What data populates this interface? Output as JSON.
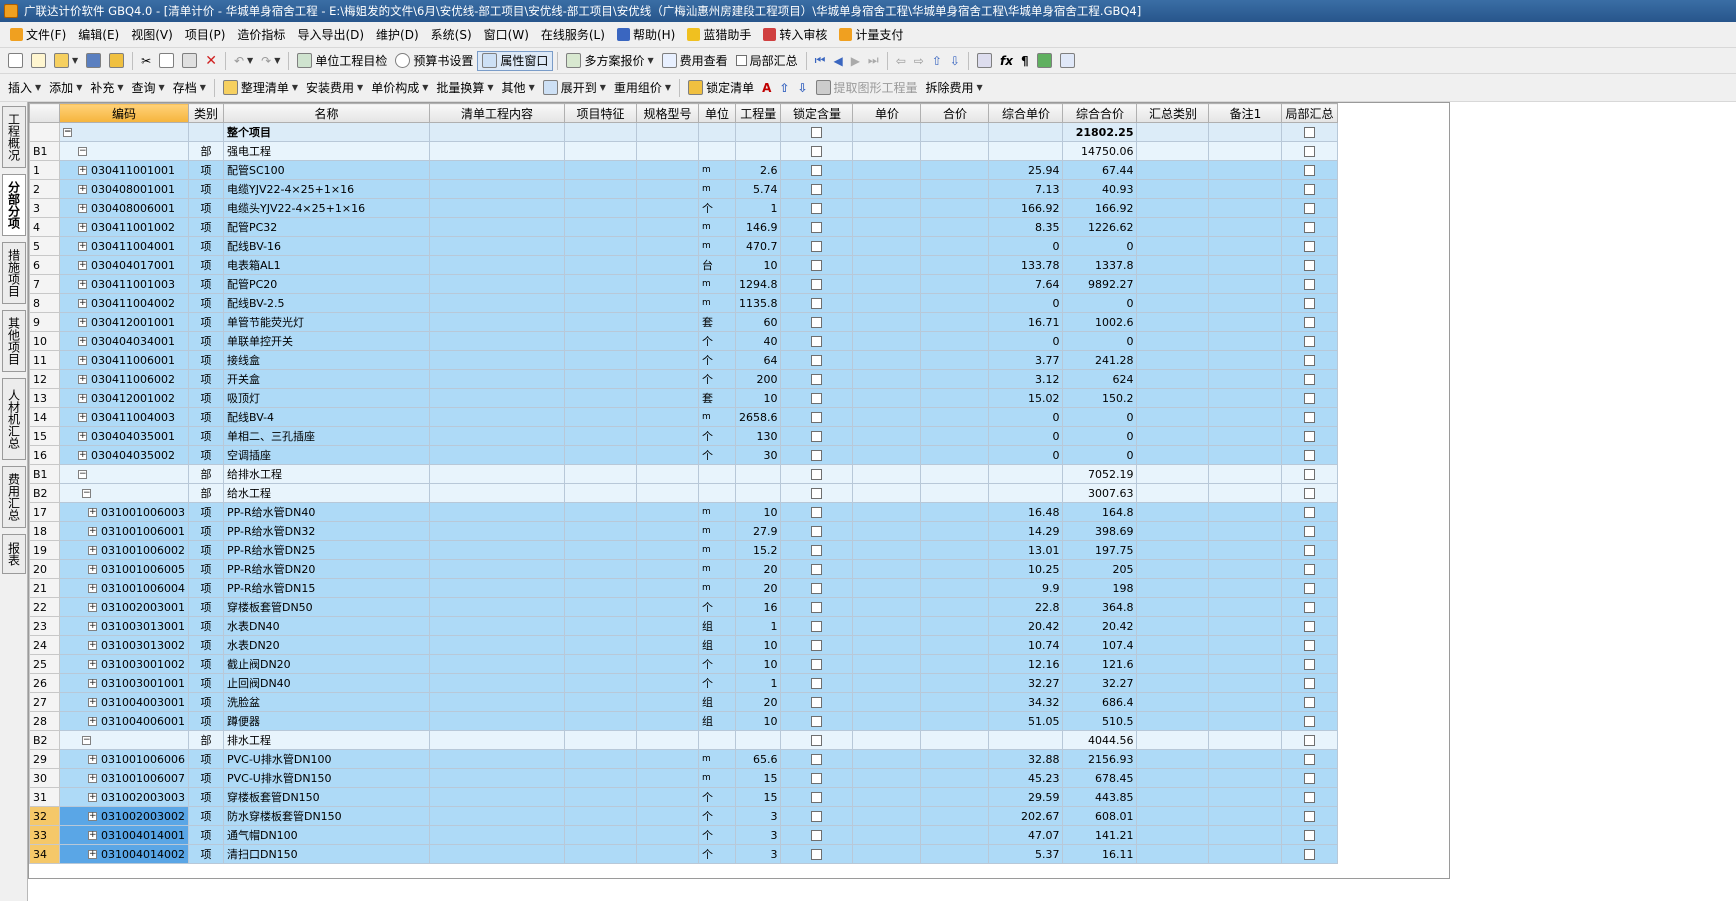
{
  "window": {
    "title": "广联达计价软件 GBQ4.0 - [清单计价 - 华城单身宿舍工程 - E:\\梅姐发的文件\\6月\\安优线-部工项目\\安优线-部工项目\\安优线（广梅汕惠州房建段工程项目）\\华城单身宿舍工程\\华城单身宿舍工程\\华城单身宿舍工程.GBQ4]"
  },
  "menu": [
    "文件(F)",
    "编辑(E)",
    "视图(V)",
    "项目(P)",
    "造价指标",
    "导入导出(D)",
    "维护(D)",
    "系统(S)",
    "窗口(W)",
    "在线服务(L)",
    "帮助(H)",
    "蓝猎助手",
    "转入审核",
    "计量支付"
  ],
  "toolbar1": {
    "unit_target": "单位工程目检",
    "budget_setting": "预算书设置",
    "property_window": "属性窗口",
    "multi_quote": "多方案报价",
    "fee_view": "费用查看",
    "local_summary": "局部汇总"
  },
  "toolbar2": [
    "插入",
    "添加",
    "补充",
    "查询",
    "存档",
    "整理清单",
    "安装费用",
    "单价构成",
    "批量换算",
    "其他",
    "展开到",
    "重用组价",
    "锁定清单",
    "提取图形工程量",
    "拆除费用"
  ],
  "left_tabs": [
    "工程概况",
    "分部分项",
    "措施项目",
    "其他项目",
    "人材机汇总",
    "费用汇总",
    "报表"
  ],
  "columns": [
    "编码",
    "类别",
    "名称",
    "清单工程内容",
    "项目特征",
    "规格型号",
    "单位",
    "工程量",
    "锁定含量",
    "单价",
    "合价",
    "综合单价",
    "综合合价",
    "汇总类别",
    "备注1",
    "局部汇总"
  ],
  "rows": [
    {
      "t": "total",
      "no": "",
      "code": "",
      "cat": "",
      "name": "整个项目",
      "unit": "",
      "qty": "",
      "price": "",
      "total": "21802.25"
    },
    {
      "t": "section",
      "no": "B1",
      "code": "",
      "cat": "部",
      "name": "强电工程",
      "unit": "",
      "qty": "",
      "price": "",
      "total": "14750.06"
    },
    {
      "t": "item",
      "no": "1",
      "code": "030411001001",
      "cat": "项",
      "name": "配管SC100",
      "unit": "m",
      "qty": "2.6",
      "price": "25.94",
      "total": "67.44"
    },
    {
      "t": "item",
      "no": "2",
      "code": "030408001001",
      "cat": "项",
      "name": "电缆YJV22-4×25+1×16",
      "unit": "m",
      "qty": "5.74",
      "price": "7.13",
      "total": "40.93"
    },
    {
      "t": "item",
      "no": "3",
      "code": "030408006001",
      "cat": "项",
      "name": "电缆头YJV22-4×25+1×16",
      "unit": "个",
      "qty": "1",
      "price": "166.92",
      "total": "166.92"
    },
    {
      "t": "item",
      "no": "4",
      "code": "030411001002",
      "cat": "项",
      "name": "配管PC32",
      "unit": "m",
      "qty": "146.9",
      "price": "8.35",
      "total": "1226.62"
    },
    {
      "t": "item",
      "no": "5",
      "code": "030411004001",
      "cat": "项",
      "name": "配线BV-16",
      "unit": "m",
      "qty": "470.7",
      "price": "0",
      "total": "0"
    },
    {
      "t": "item",
      "no": "6",
      "code": "030404017001",
      "cat": "项",
      "name": "电表箱AL1",
      "unit": "台",
      "qty": "10",
      "price": "133.78",
      "total": "1337.8"
    },
    {
      "t": "item",
      "no": "7",
      "code": "030411001003",
      "cat": "项",
      "name": "配管PC20",
      "unit": "m",
      "qty": "1294.8",
      "price": "7.64",
      "total": "9892.27"
    },
    {
      "t": "item",
      "no": "8",
      "code": "030411004002",
      "cat": "项",
      "name": "配线BV-2.5",
      "unit": "m",
      "qty": "1135.8",
      "price": "0",
      "total": "0"
    },
    {
      "t": "item",
      "no": "9",
      "code": "030412001001",
      "cat": "项",
      "name": "单管节能荧光灯",
      "unit": "套",
      "qty": "60",
      "price": "16.71",
      "total": "1002.6"
    },
    {
      "t": "item",
      "no": "10",
      "code": "030404034001",
      "cat": "项",
      "name": "单联单控开关",
      "unit": "个",
      "qty": "40",
      "price": "0",
      "total": "0"
    },
    {
      "t": "item",
      "no": "11",
      "code": "030411006001",
      "cat": "项",
      "name": "接线盒",
      "unit": "个",
      "qty": "64",
      "price": "3.77",
      "total": "241.28"
    },
    {
      "t": "item",
      "no": "12",
      "code": "030411006002",
      "cat": "项",
      "name": "开关盒",
      "unit": "个",
      "qty": "200",
      "price": "3.12",
      "total": "624"
    },
    {
      "t": "item",
      "no": "13",
      "code": "030412001002",
      "cat": "项",
      "name": "吸顶灯",
      "unit": "套",
      "qty": "10",
      "price": "15.02",
      "total": "150.2"
    },
    {
      "t": "item",
      "no": "14",
      "code": "030411004003",
      "cat": "项",
      "name": "配线BV-4",
      "unit": "m",
      "qty": "2658.6",
      "price": "0",
      "total": "0"
    },
    {
      "t": "item",
      "no": "15",
      "code": "030404035001",
      "cat": "项",
      "name": "单相二、三孔插座",
      "unit": "个",
      "qty": "130",
      "price": "0",
      "total": "0"
    },
    {
      "t": "item",
      "no": "16",
      "code": "030404035002",
      "cat": "项",
      "name": "空调插座",
      "unit": "个",
      "qty": "30",
      "price": "0",
      "total": "0"
    },
    {
      "t": "section",
      "no": "B1",
      "code": "",
      "cat": "部",
      "name": "给排水工程",
      "unit": "",
      "qty": "",
      "price": "",
      "total": "7052.19"
    },
    {
      "t": "section2",
      "no": "B2",
      "code": "",
      "cat": "部",
      "name": "给水工程",
      "unit": "",
      "qty": "",
      "price": "",
      "total": "3007.63"
    },
    {
      "t": "item2",
      "no": "17",
      "code": "031001006003",
      "cat": "项",
      "name": "PP-R给水管DN40",
      "unit": "m",
      "qty": "10",
      "price": "16.48",
      "total": "164.8"
    },
    {
      "t": "item2",
      "no": "18",
      "code": "031001006001",
      "cat": "项",
      "name": "PP-R给水管DN32",
      "unit": "m",
      "qty": "27.9",
      "price": "14.29",
      "total": "398.69"
    },
    {
      "t": "item2",
      "no": "19",
      "code": "031001006002",
      "cat": "项",
      "name": "PP-R给水管DN25",
      "unit": "m",
      "qty": "15.2",
      "price": "13.01",
      "total": "197.75"
    },
    {
      "t": "item2",
      "no": "20",
      "code": "031001006005",
      "cat": "项",
      "name": "PP-R给水管DN20",
      "unit": "m",
      "qty": "20",
      "price": "10.25",
      "total": "205"
    },
    {
      "t": "item2",
      "no": "21",
      "code": "031001006004",
      "cat": "项",
      "name": "PP-R给水管DN15",
      "unit": "m",
      "qty": "20",
      "price": "9.9",
      "total": "198"
    },
    {
      "t": "item2",
      "no": "22",
      "code": "031002003001",
      "cat": "项",
      "name": "穿楼板套管DN50",
      "unit": "个",
      "qty": "16",
      "price": "22.8",
      "total": "364.8"
    },
    {
      "t": "item2",
      "no": "23",
      "code": "031003013001",
      "cat": "项",
      "name": "水表DN40",
      "unit": "组",
      "qty": "1",
      "price": "20.42",
      "total": "20.42"
    },
    {
      "t": "item2",
      "no": "24",
      "code": "031003013002",
      "cat": "项",
      "name": "水表DN20",
      "unit": "组",
      "qty": "10",
      "price": "10.74",
      "total": "107.4"
    },
    {
      "t": "item2",
      "no": "25",
      "code": "031003001002",
      "cat": "项",
      "name": "截止阀DN20",
      "unit": "个",
      "qty": "10",
      "price": "12.16",
      "total": "121.6"
    },
    {
      "t": "item2",
      "no": "26",
      "code": "031003001001",
      "cat": "项",
      "name": "止回阀DN40",
      "unit": "个",
      "qty": "1",
      "price": "32.27",
      "total": "32.27"
    },
    {
      "t": "item2",
      "no": "27",
      "code": "031004003001",
      "cat": "项",
      "name": "洗脸盆",
      "unit": "组",
      "qty": "20",
      "price": "34.32",
      "total": "686.4"
    },
    {
      "t": "item2",
      "no": "28",
      "code": "031004006001",
      "cat": "项",
      "name": "蹲便器",
      "unit": "组",
      "qty": "10",
      "price": "51.05",
      "total": "510.5"
    },
    {
      "t": "section2",
      "no": "B2",
      "code": "",
      "cat": "部",
      "name": "排水工程",
      "unit": "",
      "qty": "",
      "price": "",
      "total": "4044.56"
    },
    {
      "t": "item2",
      "no": "29",
      "code": "031001006006",
      "cat": "项",
      "name": "PVC-U排水管DN100",
      "unit": "m",
      "qty": "65.6",
      "price": "32.88",
      "total": "2156.93"
    },
    {
      "t": "item2",
      "no": "30",
      "code": "031001006007",
      "cat": "项",
      "name": "PVC-U排水管DN150",
      "unit": "m",
      "qty": "15",
      "price": "45.23",
      "total": "678.45"
    },
    {
      "t": "item2",
      "no": "31",
      "code": "031002003003",
      "cat": "项",
      "name": "穿楼板套管DN150",
      "unit": "个",
      "qty": "15",
      "price": "29.59",
      "total": "443.85"
    },
    {
      "t": "item2sel",
      "no": "32",
      "code": "031002003002",
      "cat": "项",
      "name": "防水穿楼板套管DN150",
      "unit": "个",
      "qty": "3",
      "price": "202.67",
      "total": "608.01"
    },
    {
      "t": "item2sel",
      "no": "33",
      "code": "031004014001",
      "cat": "项",
      "name": "通气帽DN100",
      "unit": "个",
      "qty": "3",
      "price": "47.07",
      "total": "141.21"
    },
    {
      "t": "item2sel",
      "no": "34",
      "code": "031004014002",
      "cat": "项",
      "name": "清扫口DN150",
      "unit": "个",
      "qty": "3",
      "price": "5.37",
      "total": "16.11"
    }
  ]
}
